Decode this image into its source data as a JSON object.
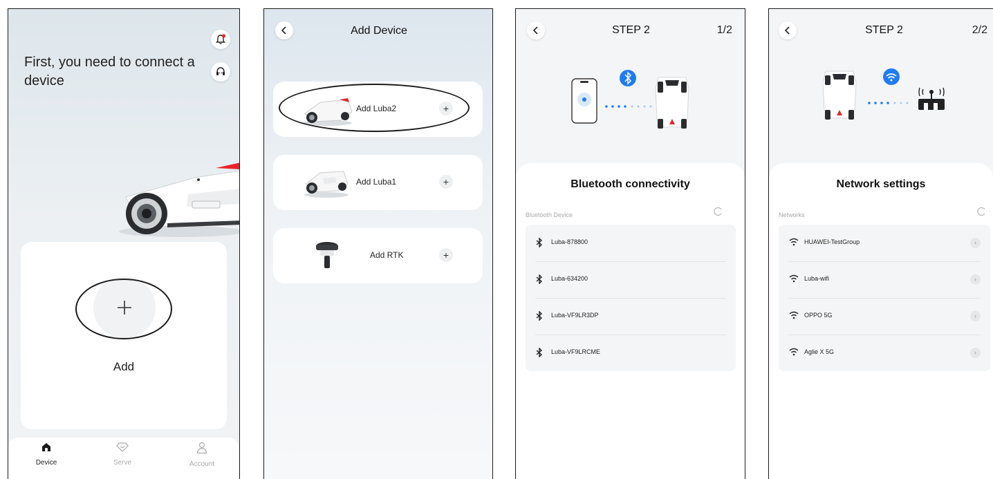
{
  "screen1": {
    "heading": "First, you need to connect a device",
    "add_label": "Add",
    "tabs": [
      {
        "label": "Device",
        "icon": "home-icon",
        "active": true
      },
      {
        "label": "Serve",
        "icon": "diamond-icon",
        "active": false
      },
      {
        "label": "Account",
        "icon": "person-icon",
        "active": false
      }
    ]
  },
  "screen2": {
    "title": "Add Device",
    "devices": [
      {
        "label": "Add Luba2",
        "plus": "+"
      },
      {
        "label": "Add Luba1",
        "plus": "+"
      },
      {
        "label": "Add RTK",
        "plus": "+"
      }
    ]
  },
  "screen3": {
    "title": "STEP 2",
    "step": "1/2",
    "sheet_title": "Bluetooth connectivity",
    "section_label": "Bluetooth Device",
    "devices": [
      "Luba-878800",
      "Luba-634200",
      "Luba-VF9LR3DP",
      "Luba-VF9LRCME"
    ]
  },
  "screen4": {
    "title": "STEP 2",
    "step": "2/2",
    "sheet_title": "Network settings",
    "section_label": "Networks",
    "networks": [
      "HUAWEI-TestGroup",
      "Luba-wifi",
      "OPPO 5G",
      "Aglie X 5G"
    ]
  },
  "colors": {
    "accent_blue": "#1f7cf2",
    "alert_red": "#e8242b"
  }
}
